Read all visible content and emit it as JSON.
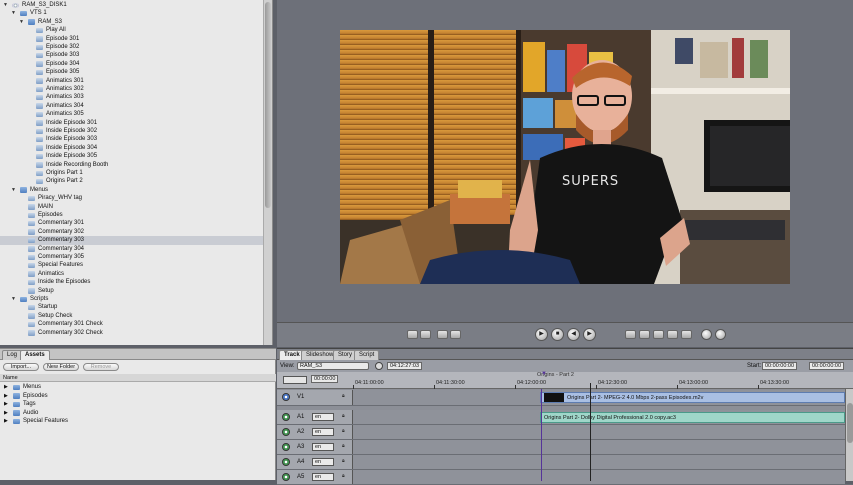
{
  "outline": {
    "items": [
      {
        "label": "RAM_S3_DISK1",
        "depth": 0,
        "icon": "disc-icon",
        "expanded": true
      },
      {
        "label": "VTS 1",
        "depth": 1,
        "icon": "folder-icon",
        "expanded": true
      },
      {
        "label": "RAM_S3",
        "depth": 2,
        "icon": "folder-icon",
        "expanded": true
      },
      {
        "label": "Play All",
        "depth": 3,
        "icon": "doc-icon"
      },
      {
        "label": "Episode 301",
        "depth": 3,
        "icon": "doc-icon"
      },
      {
        "label": "Episode 302",
        "depth": 3,
        "icon": "doc-icon"
      },
      {
        "label": "Episode 303",
        "depth": 3,
        "icon": "doc-icon"
      },
      {
        "label": "Episode 304",
        "depth": 3,
        "icon": "doc-icon"
      },
      {
        "label": "Episode 305",
        "depth": 3,
        "icon": "doc-icon"
      },
      {
        "label": "Animatics 301",
        "depth": 3,
        "icon": "doc-icon"
      },
      {
        "label": "Animatics 302",
        "depth": 3,
        "icon": "doc-icon"
      },
      {
        "label": "Animatics 303",
        "depth": 3,
        "icon": "doc-icon"
      },
      {
        "label": "Animatics 304",
        "depth": 3,
        "icon": "doc-icon"
      },
      {
        "label": "Animatics 305",
        "depth": 3,
        "icon": "doc-icon"
      },
      {
        "label": "Inside Episode 301",
        "depth": 3,
        "icon": "doc-icon"
      },
      {
        "label": "Inside Episode 302",
        "depth": 3,
        "icon": "doc-icon"
      },
      {
        "label": "Inside Episode 303",
        "depth": 3,
        "icon": "doc-icon"
      },
      {
        "label": "Inside Episode 304",
        "depth": 3,
        "icon": "doc-icon"
      },
      {
        "label": "Inside Episode 305",
        "depth": 3,
        "icon": "doc-icon"
      },
      {
        "label": "Inside Recording Booth",
        "depth": 3,
        "icon": "doc-icon"
      },
      {
        "label": "Origins Part 1",
        "depth": 3,
        "icon": "doc-icon"
      },
      {
        "label": "Origins Part 2",
        "depth": 3,
        "icon": "doc-icon"
      },
      {
        "label": "Menus",
        "depth": 1,
        "icon": "folder-icon",
        "expanded": true
      },
      {
        "label": "Piracy_WHV tag",
        "depth": 2,
        "icon": "doc-icon"
      },
      {
        "label": "MAIN",
        "depth": 2,
        "icon": "doc-icon"
      },
      {
        "label": "Episodes",
        "depth": 2,
        "icon": "doc-icon"
      },
      {
        "label": "Commentary 301",
        "depth": 2,
        "icon": "doc-icon"
      },
      {
        "label": "Commentary 302",
        "depth": 2,
        "icon": "doc-icon"
      },
      {
        "label": "Commentary 303",
        "depth": 2,
        "icon": "doc-icon",
        "selected": true
      },
      {
        "label": "Commentary 304",
        "depth": 2,
        "icon": "doc-icon"
      },
      {
        "label": "Commentary 305",
        "depth": 2,
        "icon": "doc-icon"
      },
      {
        "label": "Special Features",
        "depth": 2,
        "icon": "doc-icon"
      },
      {
        "label": "Animatics",
        "depth": 2,
        "icon": "doc-icon"
      },
      {
        "label": "Inside the Episodes",
        "depth": 2,
        "icon": "doc-icon"
      },
      {
        "label": "Setup",
        "depth": 2,
        "icon": "doc-icon"
      },
      {
        "label": "Scripts",
        "depth": 1,
        "icon": "folder-icon",
        "expanded": true
      },
      {
        "label": "Startup",
        "depth": 2,
        "icon": "doc-icon"
      },
      {
        "label": "Setup Check",
        "depth": 2,
        "icon": "doc-icon"
      },
      {
        "label": "Commentary 301 Check",
        "depth": 2,
        "icon": "doc-icon"
      },
      {
        "label": "Commentary 302 Check",
        "depth": 2,
        "icon": "doc-icon"
      }
    ]
  },
  "assets": {
    "tabs": [
      {
        "label": "Log",
        "active": false
      },
      {
        "label": "Assets",
        "active": true
      }
    ],
    "buttons": {
      "import": "Import...",
      "new_folder": "New Folder",
      "remove": "Remove"
    },
    "column_header": "Name",
    "items": [
      {
        "label": "Menus"
      },
      {
        "label": "Episodes"
      },
      {
        "label": "Tags"
      },
      {
        "label": "Audio"
      },
      {
        "label": "Special Features"
      }
    ]
  },
  "track": {
    "tabs": [
      {
        "label": "Track",
        "active": true
      },
      {
        "label": "Slideshow",
        "active": false
      },
      {
        "label": "Story",
        "active": false
      },
      {
        "label": "Script",
        "active": false
      }
    ],
    "view_label": "View:",
    "view_value": "RAM_S3",
    "current_timecode": "04:12:27:03",
    "start_label": "Start:",
    "start_value": "00:00:00:00",
    "end_value": "00:00:00:00",
    "zoom_value": "00:00:00",
    "marker_label": "Origins - Part 2",
    "ruler_labels": [
      "04:11:00:00",
      "04:11:30:00",
      "04:12:00:00",
      "04:12:30:00",
      "04:13:00:00",
      "04:13:30:00"
    ],
    "tracks": [
      {
        "name": "V1",
        "kind": "video",
        "clip": "Origins Part 2- MPEG-2 4.0 Mbps 2-pass Episodes.m2v"
      },
      {
        "name": "A1",
        "kind": "audio",
        "lang": "en",
        "clip": "Origins Part 2- Dolby Digital Professional 2.0 copy.ac3"
      },
      {
        "name": "A2",
        "kind": "audio",
        "lang": "en",
        "clip": ""
      },
      {
        "name": "A3",
        "kind": "audio",
        "lang": "en",
        "clip": ""
      },
      {
        "name": "A4",
        "kind": "audio",
        "lang": "en",
        "clip": ""
      },
      {
        "name": "A5",
        "kind": "audio",
        "lang": "en",
        "clip": ""
      }
    ]
  },
  "viewer": {
    "shirt_text": "SUPERS"
  },
  "colors": {
    "selection": "#c9ccd3",
    "video_clip": "#a9bfe3",
    "audio_clip": "#9fd6c9",
    "viewer_bg": "#6d7079"
  }
}
